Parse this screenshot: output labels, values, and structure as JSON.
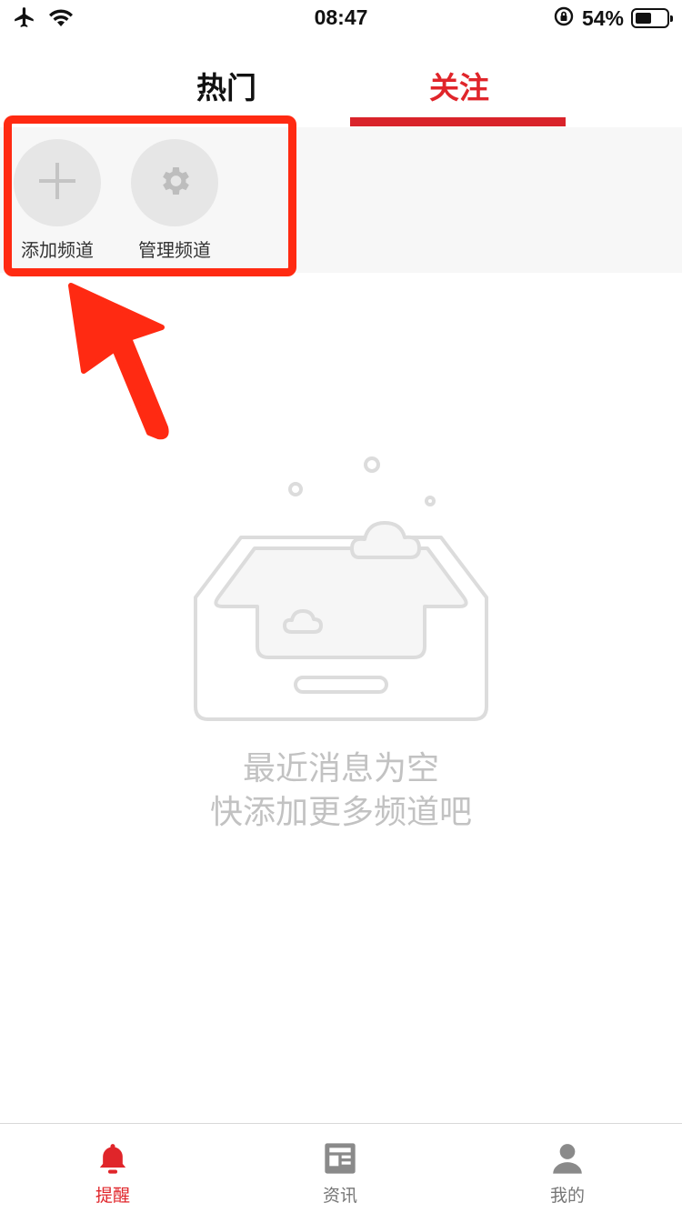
{
  "status_bar": {
    "time": "08:47",
    "battery_percent": "54%",
    "battery_level": 0.54,
    "icons": [
      "airplane-icon",
      "wifi-icon",
      "rotation-lock-icon",
      "battery-icon"
    ]
  },
  "tabs": [
    {
      "label": "热门",
      "active": false
    },
    {
      "label": "关注",
      "active": true
    }
  ],
  "channels": {
    "add_label": "添加频道",
    "manage_label": "管理频道"
  },
  "empty_state": {
    "line1": "最近消息为空",
    "line2": "快添加更多频道吧"
  },
  "bottom_nav": {
    "items": [
      {
        "label": "提醒",
        "icon": "bell-icon",
        "active": true
      },
      {
        "label": "资讯",
        "icon": "news-icon",
        "active": false
      },
      {
        "label": "我的",
        "icon": "user-icon",
        "active": false
      }
    ]
  },
  "colors": {
    "accent": "#e0252a",
    "annotation": "#ff2a12",
    "muted": "#c2c2c2"
  }
}
